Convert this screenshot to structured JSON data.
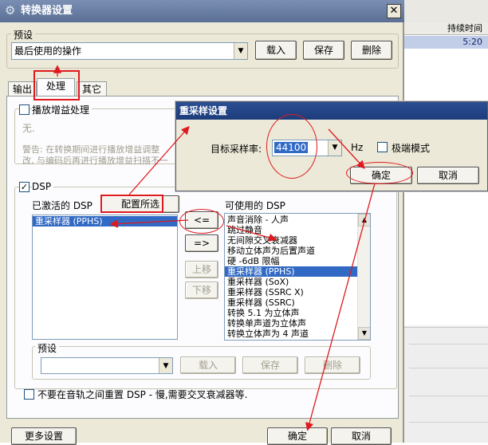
{
  "background_app": {
    "column_header": "持续时间",
    "row_value": "5:20"
  },
  "dialog": {
    "title": "转换器设置",
    "close_label": "✕",
    "preset": {
      "group_label": "预设",
      "combo_value": "最后使用的操作",
      "load_label": "载入",
      "save_label": "保存",
      "delete_label": "删除"
    },
    "tabs": [
      "输出",
      "处理",
      "其它"
    ],
    "replaygain": {
      "checkbox_label": "播放增益处理",
      "mode_text": "无.",
      "warning_line1": "警告: 在转换期间进行播放增益调整",
      "warning_line2": "改, 与编码后再进行播放增益扫描不一"
    },
    "dsp": {
      "checkbox_label": "DSP",
      "active_label": "已激活的 DSP",
      "configure_label": "配置所选",
      "available_label": "可使用的 DSP",
      "active_items": [
        "重采样器 (PPHS)"
      ],
      "available_items": [
        "声音消除 - 人声",
        "跳过静音",
        "无间隙交叉衰减器",
        "移动立体声为后置声道",
        "硬 -6dB 限幅",
        "重采样器 (PPHS)",
        "重采样器 (SoX)",
        "重采样器 (SSRC X)",
        "重采样器 (SSRC)",
        "转换 5.1 为立体声",
        "转换单声道为立体声",
        "转换立体声为 4 声道"
      ],
      "add_label": "<=",
      "remove_label": "=>",
      "up_label": "上移",
      "down_label": "下移",
      "preset_label": "预设",
      "preset_load": "载入",
      "preset_save": "保存",
      "preset_delete": "删除",
      "no_reset_label": "不要在音轨之间重置 DSP - 慢,需要交叉衰减器等."
    },
    "more_settings_label": "更多设置",
    "ok_label": "确定",
    "cancel_label": "取消"
  },
  "resampler_dialog": {
    "title": "重采样设置",
    "rate_label": "目标采样率:",
    "rate_value": "44100",
    "unit": "Hz",
    "extreme_label": "极端模式",
    "ok_label": "确定",
    "cancel_label": "取消"
  },
  "colors": {
    "annotation_red": "#e0191e",
    "selection_blue": "#316ac5",
    "dialog_bg": "#ece9d8"
  }
}
